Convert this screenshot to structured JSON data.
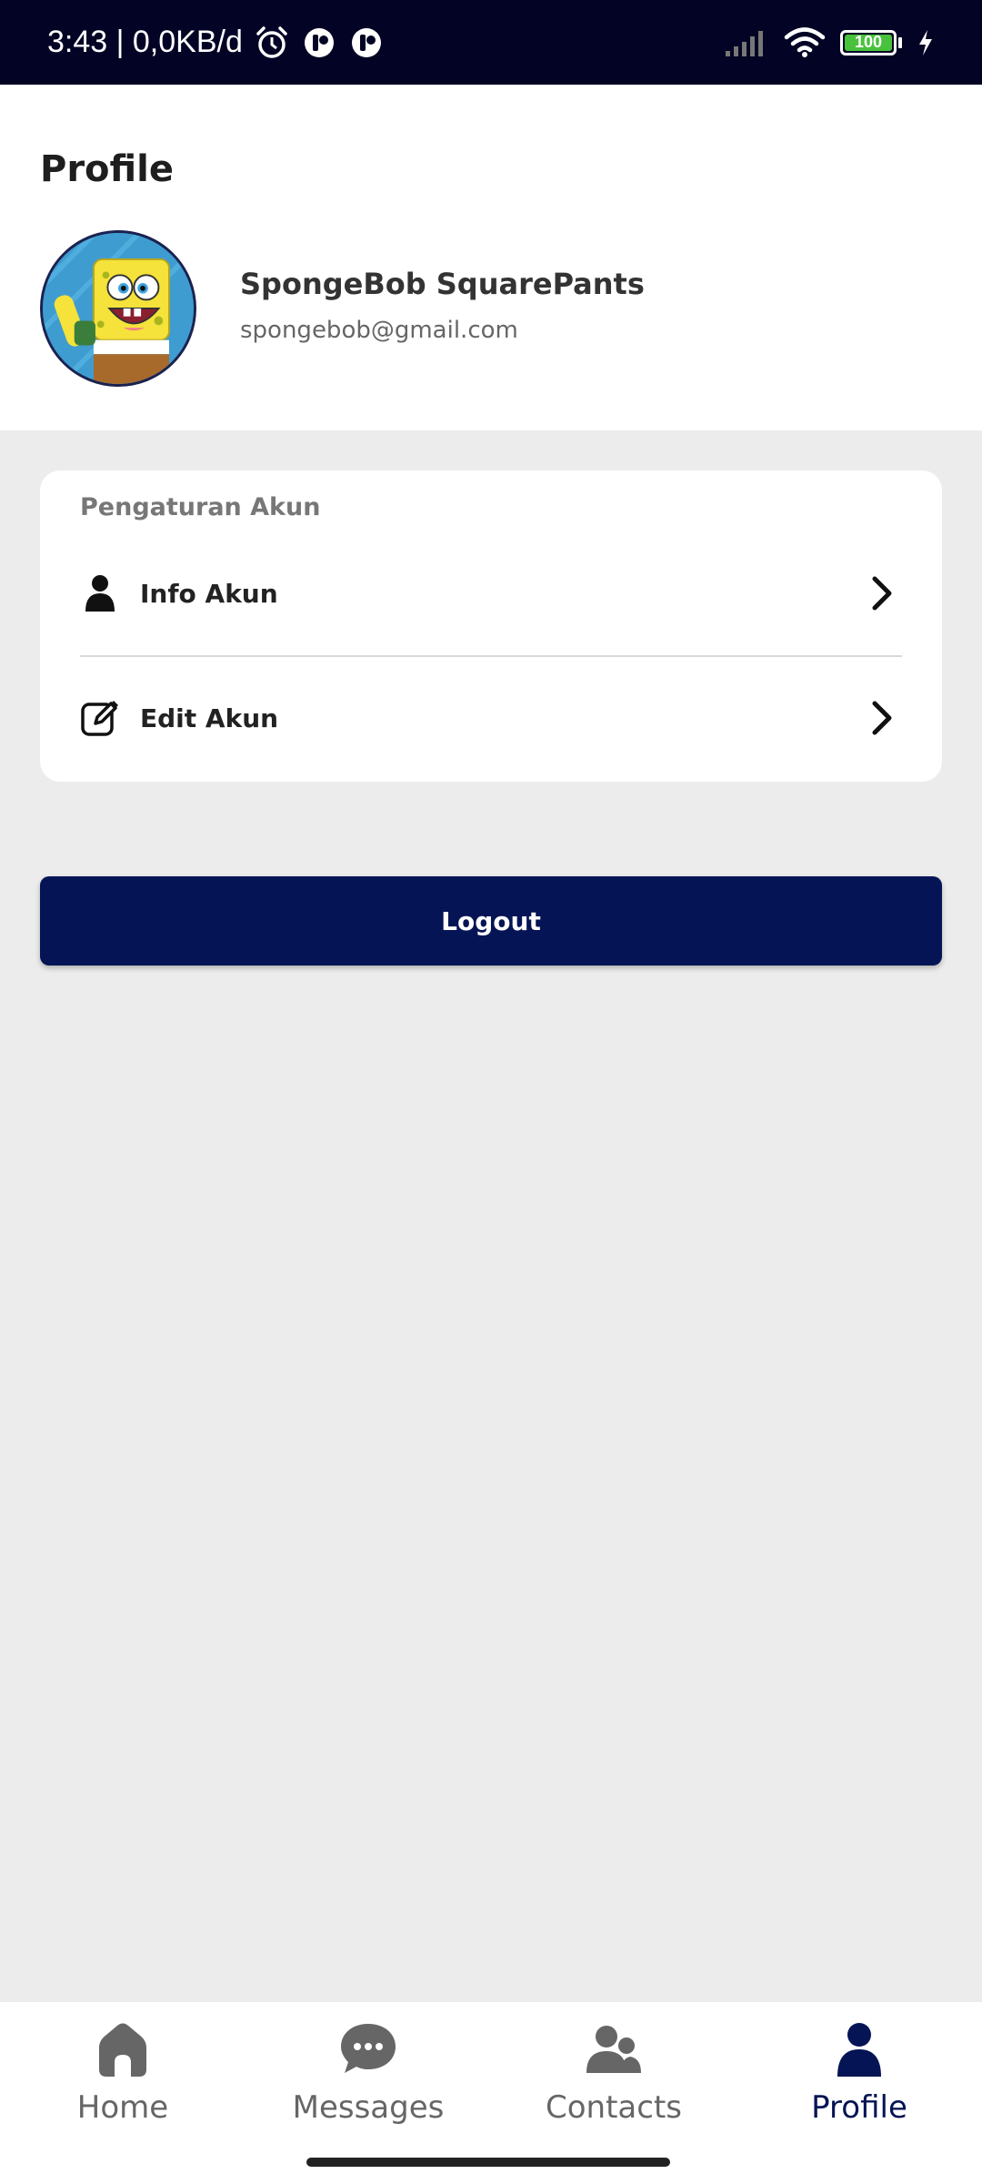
{
  "status_bar": {
    "time_text": "3:43 | 0,0KB/d",
    "battery_level": "100",
    "icons": [
      "alarm-icon",
      "app-icon",
      "app-icon",
      "signal-icon",
      "wifi-icon",
      "battery-icon",
      "charging-icon"
    ]
  },
  "header": {
    "title": "Profile",
    "user_name": "SpongeBob SquarePants",
    "user_email": "spongebob@gmail.com"
  },
  "account_settings": {
    "title": "Pengaturan Akun",
    "items": [
      {
        "label": "Info Akun",
        "icon": "person-icon"
      },
      {
        "label": "Edit Akun",
        "icon": "edit-icon"
      }
    ]
  },
  "logout_label": "Logout",
  "bottom_nav": {
    "items": [
      {
        "label": "Home",
        "icon": "home-icon"
      },
      {
        "label": "Messages",
        "icon": "chat-icon"
      },
      {
        "label": "Contacts",
        "icon": "contacts-icon"
      },
      {
        "label": "Profile",
        "icon": "profile-icon"
      }
    ],
    "active": "Profile"
  },
  "colors": {
    "primary": "#051454",
    "status_bar": "#030325",
    "background": "#ececec",
    "inactive_nav": "#666666"
  }
}
